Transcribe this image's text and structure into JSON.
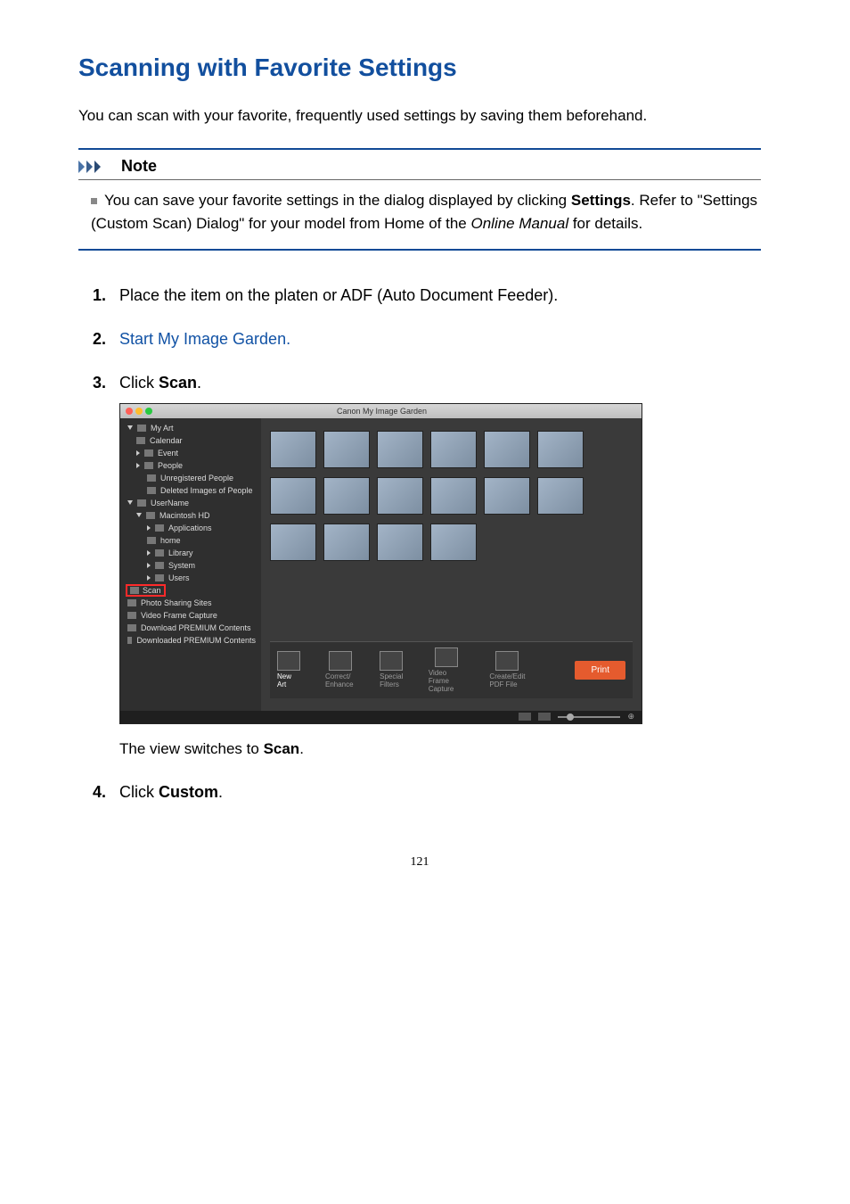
{
  "title": "Scanning with Favorite Settings",
  "intro": "You can scan with your favorite, frequently used settings by saving them beforehand.",
  "note": {
    "heading": "Note",
    "body_pre": "You can save your favorite settings in the dialog displayed by clicking ",
    "settings_word": "Settings",
    "body_mid": ". Refer to \"Settings (Custom Scan) Dialog\" for your model from Home of the ",
    "online_manual": "Online Manual",
    "body_post": " for details."
  },
  "steps": {
    "s1": {
      "num": "1.",
      "text": "Place the item on the platen or ADF (Auto Document Feeder)."
    },
    "s2": {
      "num": "2.",
      "link": "Start My Image Garden."
    },
    "s3": {
      "num": "3.",
      "pre": "Click ",
      "bold": "Scan",
      "post": "."
    },
    "s4": {
      "num": "4.",
      "pre": "Click ",
      "bold": "Custom",
      "post": "."
    }
  },
  "screenshot": {
    "window_title": "Canon My Image Garden",
    "sidebar": {
      "my_art": "My Art",
      "calendar": "Calendar",
      "event": "Event",
      "people": "People",
      "unregistered": "Unregistered People",
      "deleted": "Deleted Images of People",
      "username": "UserName",
      "mac_hd": "Macintosh HD",
      "applications": "Applications",
      "home": "home",
      "library": "Library",
      "system": "System",
      "users": "Users",
      "scan": "Scan",
      "photo_sharing": "Photo Sharing Sites",
      "video_frame": "Video Frame Capture",
      "dl_premium": "Download PREMIUM Contents",
      "dled_premium": "Downloaded PREMIUM Contents"
    },
    "toolbar": {
      "new_art": "New Art",
      "correct_enhance": "Correct/\nEnhance",
      "special_filters": "Special\nFilters",
      "video_frame_capture": "Video Frame\nCapture",
      "create_edit_pdf": "Create/Edit\nPDF File",
      "print": "Print"
    }
  },
  "caption": {
    "pre": "The view switches to ",
    "bold": "Scan",
    "post": "."
  },
  "page_number": "121"
}
